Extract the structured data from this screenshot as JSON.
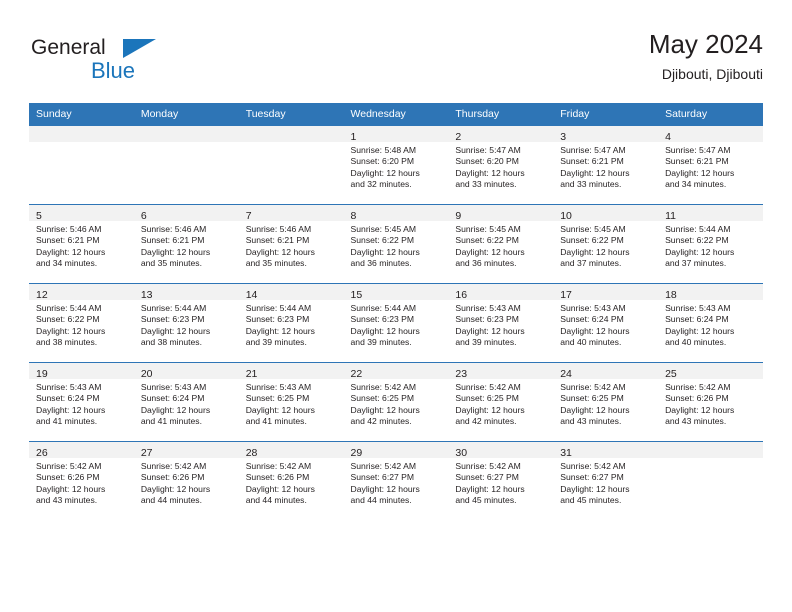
{
  "brand": {
    "name_top": "General",
    "name_bottom": "Blue",
    "triangle_icon": "brand-triangle-icon",
    "color_primary": "#1b75bb",
    "color_text": "#231f20"
  },
  "header": {
    "title": "May 2024",
    "subtitle": "Djibouti, Djibouti"
  },
  "calendar": {
    "header_bg": "#2e75b6",
    "header_text_color": "#ffffff",
    "daynum_strip_bg": "#f2f2f2",
    "weekday_headers": [
      "Sunday",
      "Monday",
      "Tuesday",
      "Wednesday",
      "Thursday",
      "Friday",
      "Saturday"
    ],
    "weeks": [
      [
        {
          "day": "",
          "lines": []
        },
        {
          "day": "",
          "lines": []
        },
        {
          "day": "",
          "lines": []
        },
        {
          "day": "1",
          "lines": [
            "Sunrise: 5:48 AM",
            "Sunset: 6:20 PM",
            "Daylight: 12 hours",
            "and 32 minutes."
          ]
        },
        {
          "day": "2",
          "lines": [
            "Sunrise: 5:47 AM",
            "Sunset: 6:20 PM",
            "Daylight: 12 hours",
            "and 33 minutes."
          ]
        },
        {
          "day": "3",
          "lines": [
            "Sunrise: 5:47 AM",
            "Sunset: 6:21 PM",
            "Daylight: 12 hours",
            "and 33 minutes."
          ]
        },
        {
          "day": "4",
          "lines": [
            "Sunrise: 5:47 AM",
            "Sunset: 6:21 PM",
            "Daylight: 12 hours",
            "and 34 minutes."
          ]
        }
      ],
      [
        {
          "day": "5",
          "lines": [
            "Sunrise: 5:46 AM",
            "Sunset: 6:21 PM",
            "Daylight: 12 hours",
            "and 34 minutes."
          ]
        },
        {
          "day": "6",
          "lines": [
            "Sunrise: 5:46 AM",
            "Sunset: 6:21 PM",
            "Daylight: 12 hours",
            "and 35 minutes."
          ]
        },
        {
          "day": "7",
          "lines": [
            "Sunrise: 5:46 AM",
            "Sunset: 6:21 PM",
            "Daylight: 12 hours",
            "and 35 minutes."
          ]
        },
        {
          "day": "8",
          "lines": [
            "Sunrise: 5:45 AM",
            "Sunset: 6:22 PM",
            "Daylight: 12 hours",
            "and 36 minutes."
          ]
        },
        {
          "day": "9",
          "lines": [
            "Sunrise: 5:45 AM",
            "Sunset: 6:22 PM",
            "Daylight: 12 hours",
            "and 36 minutes."
          ]
        },
        {
          "day": "10",
          "lines": [
            "Sunrise: 5:45 AM",
            "Sunset: 6:22 PM",
            "Daylight: 12 hours",
            "and 37 minutes."
          ]
        },
        {
          "day": "11",
          "lines": [
            "Sunrise: 5:44 AM",
            "Sunset: 6:22 PM",
            "Daylight: 12 hours",
            "and 37 minutes."
          ]
        }
      ],
      [
        {
          "day": "12",
          "lines": [
            "Sunrise: 5:44 AM",
            "Sunset: 6:22 PM",
            "Daylight: 12 hours",
            "and 38 minutes."
          ]
        },
        {
          "day": "13",
          "lines": [
            "Sunrise: 5:44 AM",
            "Sunset: 6:23 PM",
            "Daylight: 12 hours",
            "and 38 minutes."
          ]
        },
        {
          "day": "14",
          "lines": [
            "Sunrise: 5:44 AM",
            "Sunset: 6:23 PM",
            "Daylight: 12 hours",
            "and 39 minutes."
          ]
        },
        {
          "day": "15",
          "lines": [
            "Sunrise: 5:44 AM",
            "Sunset: 6:23 PM",
            "Daylight: 12 hours",
            "and 39 minutes."
          ]
        },
        {
          "day": "16",
          "lines": [
            "Sunrise: 5:43 AM",
            "Sunset: 6:23 PM",
            "Daylight: 12 hours",
            "and 39 minutes."
          ]
        },
        {
          "day": "17",
          "lines": [
            "Sunrise: 5:43 AM",
            "Sunset: 6:24 PM",
            "Daylight: 12 hours",
            "and 40 minutes."
          ]
        },
        {
          "day": "18",
          "lines": [
            "Sunrise: 5:43 AM",
            "Sunset: 6:24 PM",
            "Daylight: 12 hours",
            "and 40 minutes."
          ]
        }
      ],
      [
        {
          "day": "19",
          "lines": [
            "Sunrise: 5:43 AM",
            "Sunset: 6:24 PM",
            "Daylight: 12 hours",
            "and 41 minutes."
          ]
        },
        {
          "day": "20",
          "lines": [
            "Sunrise: 5:43 AM",
            "Sunset: 6:24 PM",
            "Daylight: 12 hours",
            "and 41 minutes."
          ]
        },
        {
          "day": "21",
          "lines": [
            "Sunrise: 5:43 AM",
            "Sunset: 6:25 PM",
            "Daylight: 12 hours",
            "and 41 minutes."
          ]
        },
        {
          "day": "22",
          "lines": [
            "Sunrise: 5:42 AM",
            "Sunset: 6:25 PM",
            "Daylight: 12 hours",
            "and 42 minutes."
          ]
        },
        {
          "day": "23",
          "lines": [
            "Sunrise: 5:42 AM",
            "Sunset: 6:25 PM",
            "Daylight: 12 hours",
            "and 42 minutes."
          ]
        },
        {
          "day": "24",
          "lines": [
            "Sunrise: 5:42 AM",
            "Sunset: 6:25 PM",
            "Daylight: 12 hours",
            "and 43 minutes."
          ]
        },
        {
          "day": "25",
          "lines": [
            "Sunrise: 5:42 AM",
            "Sunset: 6:26 PM",
            "Daylight: 12 hours",
            "and 43 minutes."
          ]
        }
      ],
      [
        {
          "day": "26",
          "lines": [
            "Sunrise: 5:42 AM",
            "Sunset: 6:26 PM",
            "Daylight: 12 hours",
            "and 43 minutes."
          ]
        },
        {
          "day": "27",
          "lines": [
            "Sunrise: 5:42 AM",
            "Sunset: 6:26 PM",
            "Daylight: 12 hours",
            "and 44 minutes."
          ]
        },
        {
          "day": "28",
          "lines": [
            "Sunrise: 5:42 AM",
            "Sunset: 6:26 PM",
            "Daylight: 12 hours",
            "and 44 minutes."
          ]
        },
        {
          "day": "29",
          "lines": [
            "Sunrise: 5:42 AM",
            "Sunset: 6:27 PM",
            "Daylight: 12 hours",
            "and 44 minutes."
          ]
        },
        {
          "day": "30",
          "lines": [
            "Sunrise: 5:42 AM",
            "Sunset: 6:27 PM",
            "Daylight: 12 hours",
            "and 45 minutes."
          ]
        },
        {
          "day": "31",
          "lines": [
            "Sunrise: 5:42 AM",
            "Sunset: 6:27 PM",
            "Daylight: 12 hours",
            "and 45 minutes."
          ]
        },
        {
          "day": "",
          "lines": []
        }
      ]
    ]
  }
}
